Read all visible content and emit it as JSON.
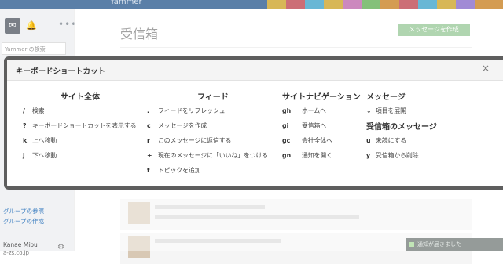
{
  "app": {
    "brand": "Yammer",
    "search_placeholder": "Yammer の検索",
    "page_title": "受信箱",
    "compose_label": "メッセージを作成",
    "sidebar_links": [
      "グループの参照",
      "グループの作成"
    ],
    "user_name": "Kanae Mibu",
    "user_email": "a-zs.co.jp",
    "toast_text": "通知が届きました"
  },
  "icons": {
    "mail": "mail-icon",
    "bell": "bell-icon",
    "more": "more-icon",
    "gear": "gear-icon",
    "close": "close-icon"
  },
  "modal": {
    "title": "キーボードショートカット",
    "close_symbol": "×",
    "sections": [
      {
        "heading": "サイト全体",
        "items": [
          {
            "key": "/",
            "label": "検索"
          },
          {
            "key": "?",
            "label": "キーボードショートカットを表示する"
          },
          {
            "key": "k",
            "label": "上へ移動"
          },
          {
            "key": "j",
            "label": "下へ移動"
          }
        ]
      },
      {
        "heading": "フィード",
        "items": [
          {
            "key": ".",
            "label": "フィードをリフレッシュ"
          },
          {
            "key": "c",
            "label": "メッセージを作成"
          },
          {
            "key": "r",
            "label": "このメッセージに返信する"
          },
          {
            "key": "+",
            "label": "現在のメッセージに「いいね」をつける"
          },
          {
            "key": "t",
            "label": "トピックを追加"
          }
        ]
      },
      {
        "heading": "サイトナビゲーション",
        "items": [
          {
            "key": "gh",
            "label": "ホームへ"
          },
          {
            "key": "gi",
            "label": "受信箱へ"
          },
          {
            "key": "gc",
            "label": "会社全体へ"
          },
          {
            "key": "gn",
            "label": "通知を開く"
          }
        ]
      },
      {
        "heading": "メッセージ",
        "items": [
          {
            "key": "⌄",
            "label": "項目を展開"
          }
        ]
      },
      {
        "heading": "受信箱のメッセージ",
        "items": [
          {
            "key": "u",
            "label": "未読にする"
          },
          {
            "key": "y",
            "label": "受信箱から削除"
          }
        ]
      }
    ]
  },
  "colors": {
    "accent_green": "#6fb26f",
    "link_blue": "#3d7fc1",
    "modal_border": "#5e5e5e"
  }
}
